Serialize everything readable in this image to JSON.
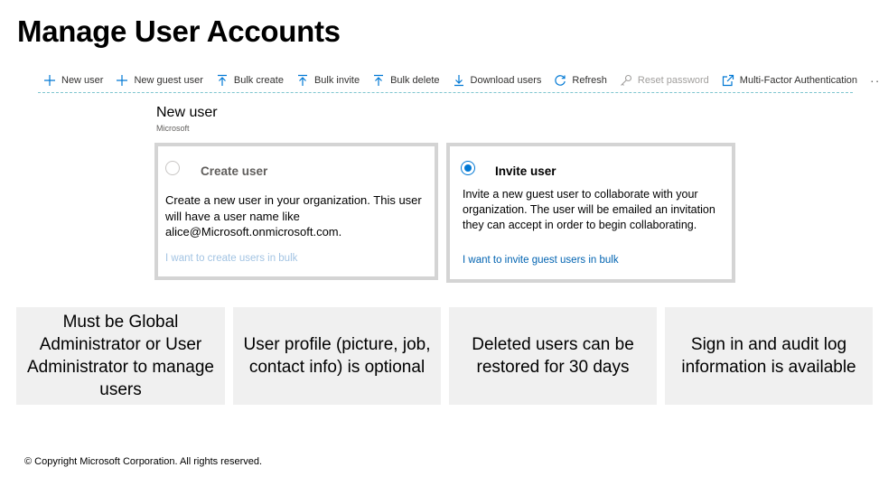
{
  "page": {
    "title": "Manage User Accounts",
    "copyright": "© Copyright Microsoft Corporation. All rights reserved."
  },
  "toolbar": {
    "items": [
      {
        "label": "New user",
        "icon": "plus-icon"
      },
      {
        "label": "New guest user",
        "icon": "plus-icon"
      },
      {
        "label": "Bulk create",
        "icon": "upload-arrow-icon"
      },
      {
        "label": "Bulk invite",
        "icon": "upload-arrow-icon"
      },
      {
        "label": "Bulk delete",
        "icon": "upload-arrow-icon"
      },
      {
        "label": "Download users",
        "icon": "download-arrow-icon"
      },
      {
        "label": "Refresh",
        "icon": "refresh-icon"
      },
      {
        "label": "Reset password",
        "icon": "key-icon",
        "disabled": true
      },
      {
        "label": "Multi-Factor Authentication",
        "icon": "external-link-icon"
      }
    ],
    "more": "···"
  },
  "blade": {
    "title": "New user",
    "subtitle": "Microsoft"
  },
  "options": {
    "create": {
      "heading": "Create user",
      "selected": false,
      "description": "Create a new user in your organization. This user will have a user name like alice@Microsoft.onmicrosoft.com.",
      "link": "I want to create users in bulk"
    },
    "invite": {
      "heading": "Invite user",
      "selected": true,
      "description": "Invite a new guest user to collaborate with your organization. The user will be emailed an invitation they can accept in order to begin collaborating.",
      "link": "I want to invite guest users in bulk"
    }
  },
  "tiles": [
    "Must be Global Administrator or User Administrator to manage users",
    "User profile (picture, job, contact info) is optional",
    "Deleted users can be restored for 30 days",
    "Sign in and audit log information is available"
  ],
  "colors": {
    "accent": "#0078d4",
    "link": "#0063b1",
    "tile_bg": "#f0f0f0",
    "card_border": "#d4d4d4"
  }
}
